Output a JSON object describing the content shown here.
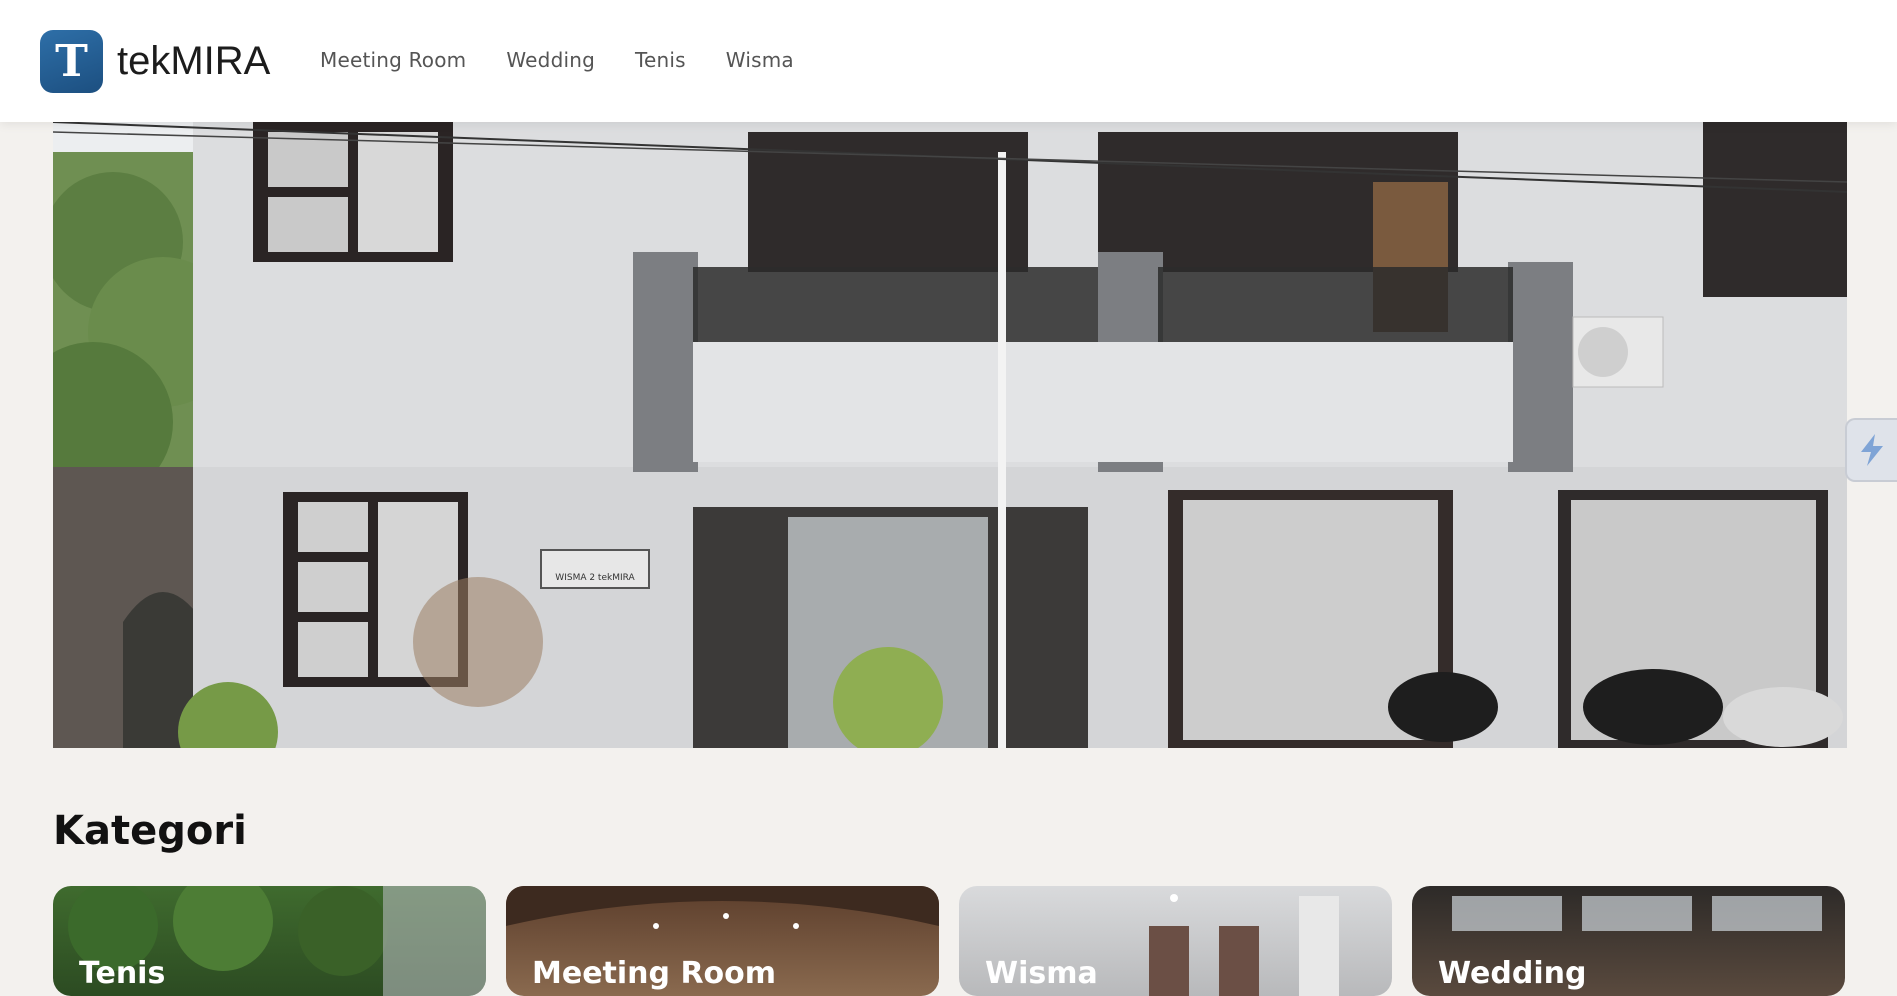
{
  "brand": {
    "letter": "T",
    "name": "tekMIRA"
  },
  "nav": [
    {
      "label": "Meeting Room"
    },
    {
      "label": "Wedding"
    },
    {
      "label": "Tenis"
    },
    {
      "label": "Wisma"
    }
  ],
  "hero": {
    "sign_text": "WISMA 2 tekMIRA"
  },
  "section": {
    "title": "Kategori"
  },
  "categories": [
    {
      "label": "Tenis"
    },
    {
      "label": "Meeting Room"
    },
    {
      "label": "Wisma"
    },
    {
      "label": "Wedding"
    }
  ],
  "colors": {
    "accent": "#2e6fa8",
    "page_bg": "#f3f1ee",
    "nav_text": "#555555"
  }
}
